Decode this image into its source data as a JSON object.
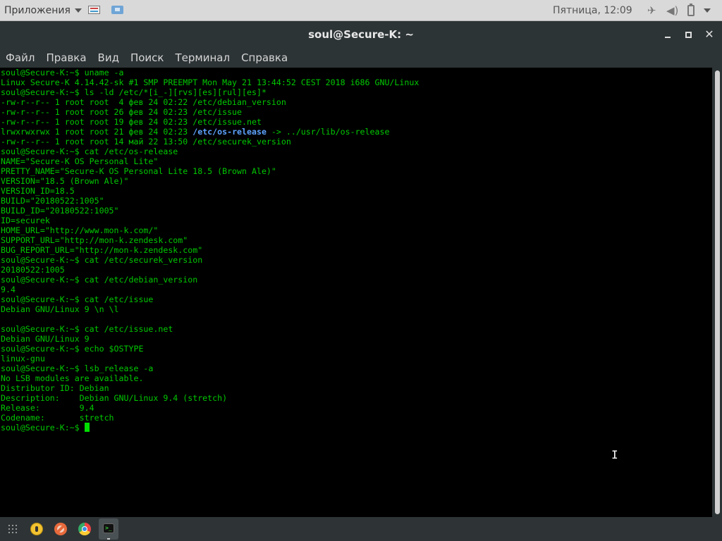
{
  "top_panel": {
    "apps_label": "Приложения",
    "clock": "Пятница, 12:09",
    "icons": [
      "files-icon",
      "window-icon",
      "network-icon",
      "volume-icon",
      "battery-icon",
      "system-menu-caret"
    ]
  },
  "window": {
    "title": "soul@Secure-K: ~",
    "minimize": "minimize-icon",
    "maximize": "maximize-icon",
    "close": "✕"
  },
  "menubar": {
    "items": [
      "Файл",
      "Правка",
      "Вид",
      "Поиск",
      "Терминал",
      "Справка"
    ]
  },
  "terminal": {
    "prompt": "soul@Secure-K:~$ ",
    "text_color": "#00c800",
    "highlight_color": "#5ea3ff",
    "lines": [
      "soul@Secure-K:~$ uname -a",
      "Linux Secure-K 4.14.42-sk #1 SMP PREEMPT Mon May 21 13:44:52 CEST 2018 i686 GNU/Linux",
      "soul@Secure-K:~$ ls -ld /etc/*[i_-][rvs][es][rul][es]*",
      "-rw-r--r-- 1 root root  4 фев 24 02:22 /etc/debian_version",
      "-rw-r--r-- 1 root root 26 фев 24 02:23 /etc/issue",
      "-rw-r--r-- 1 root root 19 фев 24 02:23 /etc/issue.net",
      "lrwxrwxrwx 1 root root 21 фев 24 02:23 ",
      "-rw-r--r-- 1 root root 14 май 22 13:50 /etc/securek_version",
      "soul@Secure-K:~$ cat /etc/os-release",
      "NAME=\"Secure-K OS Personal Lite\"",
      "PRETTY_NAME=\"Secure-K OS Personal Lite 18.5 (Brown Ale)\"",
      "VERSION=\"18.5 (Brown Ale)\"",
      "VERSION_ID=18.5",
      "BUILD=\"20180522:1005\"",
      "BUILD_ID=\"20180522:1005\"",
      "ID=securek",
      "HOME_URL=\"http://www.mon-k.com/\"",
      "SUPPORT_URL=\"http://mon-k.zendesk.com\"",
      "BUG_REPORT_URL=\"http://mon-k.zendesk.com\"",
      "soul@Secure-K:~$ cat /etc/securek_version",
      "20180522:1005",
      "soul@Secure-K:~$ cat /etc/debian_version",
      "9.4",
      "soul@Secure-K:~$ cat /etc/issue",
      "Debian GNU/Linux 9 \\n \\l",
      "",
      "soul@Secure-K:~$ cat /etc/issue.net",
      "Debian GNU/Linux 9",
      "soul@Secure-K:~$ echo $OSTYPE",
      "linux-gnu",
      "soul@Secure-K:~$ lsb_release -a",
      "No LSB modules are available.",
      "Distributor ID: Debian",
      "Description:    Debian GNU/Linux 9.4 (stretch)",
      "Release:        9.4",
      "Codename:       stretch"
    ],
    "symlink_line_index": 6,
    "symlink_name": "/etc/os-release",
    "symlink_target": " -> ../usr/lib/os-release"
  },
  "dock": {
    "icons": [
      "show-apps-icon",
      "yellow-app-icon",
      "red-app-icon",
      "browser-icon",
      "terminal-icon"
    ],
    "terminal_glyph": ">_"
  }
}
